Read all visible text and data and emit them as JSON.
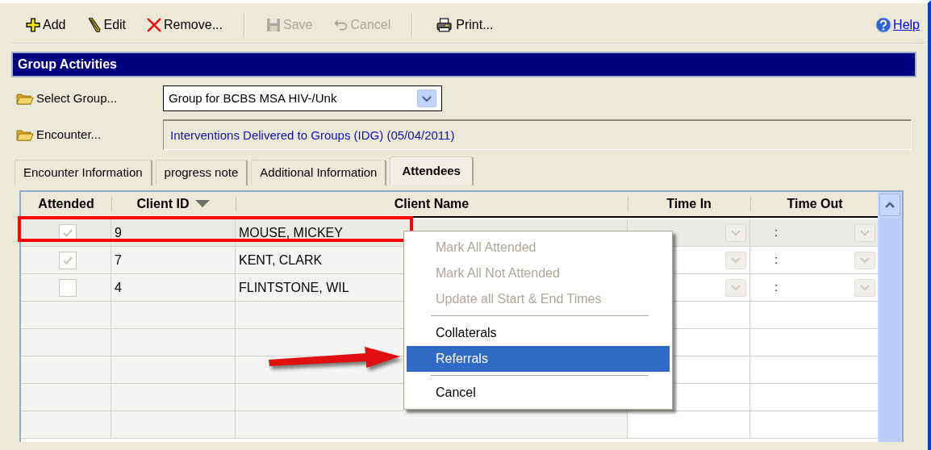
{
  "toolbar": {
    "items": [
      {
        "kind": "add",
        "label": "Add",
        "disabled": false
      },
      {
        "kind": "edit",
        "label": "Edit",
        "disabled": false
      },
      {
        "kind": "remove",
        "label": "Remove...",
        "disabled": false
      },
      {
        "kind": "separator"
      },
      {
        "kind": "save",
        "label": "Save",
        "disabled": true
      },
      {
        "kind": "cancel",
        "label": "Cancel",
        "disabled": true
      },
      {
        "kind": "separator"
      },
      {
        "kind": "print",
        "label": "Print...",
        "disabled": false
      }
    ],
    "help": "Help"
  },
  "title": "Group Activities",
  "select_group": {
    "button": "Select Group...",
    "value": "Group for BCBS MSA HIV-/Unk"
  },
  "encounter": {
    "button": "Encounter...",
    "value": "Interventions Delivered to Groups (IDG) (05/04/2011)"
  },
  "tabs": [
    {
      "label": "Encounter Information",
      "selected": false
    },
    {
      "label": "progress note",
      "selected": false
    },
    {
      "label": "Additional Information",
      "selected": false
    },
    {
      "label": "Attendees",
      "selected": true
    }
  ],
  "table": {
    "columns": [
      {
        "label": "Attended",
        "sorted": false
      },
      {
        "label": "Client ID",
        "sorted": true
      },
      {
        "label": "Client Name",
        "sorted": false
      },
      {
        "label": "Time In",
        "sorted": false
      },
      {
        "label": "Time Out",
        "sorted": false
      }
    ],
    "rows": [
      {
        "attended": true,
        "client_id": "9",
        "client_name": "MOUSE, MICKEY",
        "time_out": ":",
        "selected": true
      },
      {
        "attended": true,
        "client_id": "7",
        "client_name": "KENT, CLARK",
        "time_out": ":",
        "selected": false
      },
      {
        "attended": false,
        "client_id": "4",
        "client_name": "FLINTSTONE, WIL",
        "time_out": ":",
        "selected": false
      }
    ]
  },
  "context_menu": {
    "items": [
      {
        "kind": "item",
        "label": "Mark All Attended",
        "disabled": true,
        "selected": false
      },
      {
        "kind": "item",
        "label": "Mark All Not Attended",
        "disabled": true,
        "selected": false
      },
      {
        "kind": "item",
        "label": "Update all Start & End Times",
        "disabled": true,
        "selected": false
      },
      {
        "kind": "separator"
      },
      {
        "kind": "item",
        "label": "Collaterals",
        "disabled": false,
        "selected": false
      },
      {
        "kind": "item",
        "label": "Referrals",
        "disabled": false,
        "selected": true
      },
      {
        "kind": "separator"
      },
      {
        "kind": "item",
        "label": "Cancel",
        "disabled": false,
        "selected": false
      }
    ]
  }
}
